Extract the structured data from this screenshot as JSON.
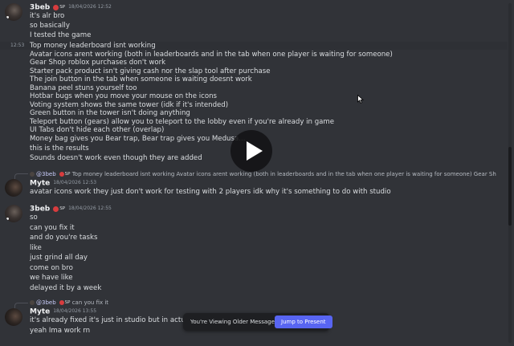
{
  "messages": {
    "m1": {
      "author": "3beb",
      "tag": "SP",
      "timestamp": "18/04/2026 12:52",
      "lines": [
        "it's alr bro",
        "so basically",
        "I tested the game"
      ]
    },
    "m1b": {
      "hover_time": "12:53",
      "lines": [
        "Top money leaderboard isnt working",
        "Avatar icons arent working (both in leaderboards and in the tab when one player is waiting for someone)",
        "Gear Shop roblox purchases don't work",
        "Starter pack product isn't giving cash nor the slap tool after purchase",
        "The join button in the tab when someone is waiting doesnt work",
        "Banana peel stuns yourself too",
        "Hotbar bugs when you move your mouse on the icons",
        "Voting system shows the same tower (idk if it's intended)",
        "Green button in the tower isn't doing anything",
        "Teleport button (gears) allow you to teleport to the lobby even if you're already in game",
        "UI Tabs don't hide each other (overlap)",
        "Money bag gives you Bear trap, Bear trap gives you Medusa...",
        "this is the results",
        "Sounds doesn't work even though they are added"
      ]
    },
    "m2": {
      "reply_author": "@3beb",
      "reply_tag": "SP",
      "reply_text": "Top money leaderboard isnt working Avatar icons arent working (both in leaderboards and in the tab when one player is waiting for someone) Gear Shop roblox purch...",
      "author": "Myte",
      "timestamp": "18/04/2026 12:53",
      "lines": [
        "avatar icons work they just don't work for testing with 2 players idk why it's something to do with studio"
      ]
    },
    "m3": {
      "author": "3beb",
      "tag": "SP",
      "timestamp": "18/04/2026 12:55",
      "lines": [
        "so",
        "can you fix it",
        "and do you're tasks",
        "like",
        "just grind all day",
        "come on bro",
        "we have like",
        "delayed it by a week"
      ]
    },
    "m4": {
      "reply_author": "@3beb",
      "reply_tag": "SP",
      "reply_text": "can you fix it",
      "author": "Myte",
      "timestamp": "18/04/2026 13:55",
      "lines": [
        "it's already fixed it's just in studio but in actual game",
        "yeah Ima work rn"
      ]
    }
  },
  "older_bar": {
    "text": "You're Viewing Older Messages",
    "jump_label": "Jump to Present"
  },
  "colors": {
    "background": "#313338",
    "accent": "#5865f2",
    "tag_red": "#d83c3e"
  },
  "icons": [
    "play-icon",
    "mouse-cursor-icon",
    "role-tag-icon"
  ]
}
